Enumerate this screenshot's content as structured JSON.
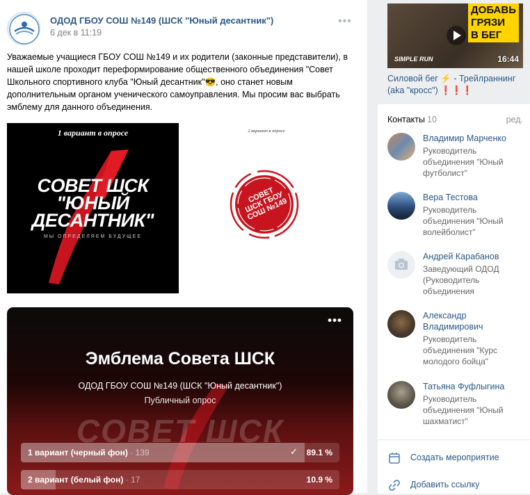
{
  "post": {
    "author": "ОДОД ГБОУ СОШ №149 (ШСК \"Юный десантник\")",
    "date": "6 дек в 11:19",
    "text_before_emoji": "Уважаемые учащиеся ГБОУ СОШ №149 и их родители (законные представители), в нашей школе проходит переформирование общественного объединения \"Совет Школьного спортивного клуба \"Юный десантник\"",
    "emoji": "😎",
    "text_after_emoji": ", оно станет новым дополнительным органом ученического самоуправления. Мы просим вас выбрать эмблему для данного объединения.",
    "image1": {
      "caption": "1 вариант в опросе",
      "line1": "СОВЕТ ШСК",
      "line2": "\"ЮНЫЙ",
      "line3": "ДЕСАНТНИК\"",
      "tagline": "МЫ ОПРЕДЕЛЯЕМ БУДУЩЕЕ"
    },
    "image2": {
      "caption": "2 вариант в опросе",
      "line1": "СОВЕТ",
      "line2": "ШСК ГБОУ",
      "line3": "СОШ №149"
    }
  },
  "poll": {
    "title": "Эмблема Совета ШСК",
    "owner": "ОДОД ГБОУ СОШ №149 (ШСК \"Юный десантник\")",
    "type": "Публичный опрос",
    "background_text": "СОВЕТ ШСК",
    "options": [
      {
        "label": "1 вариант (черный фон)",
        "count": "139",
        "percent": "89.1 %",
        "share": 0.891,
        "voted": true
      },
      {
        "label": "2 вариант (белый фон)",
        "count": "17",
        "percent": "10.9 %",
        "share": 0.109,
        "voted": false
      }
    ],
    "count_separator": " · "
  },
  "sidebar": {
    "video": {
      "overlay_line1": "ДОБАВЬ",
      "overlay_line2": "ГРЯЗИ",
      "overlay_line3": "В БЕГ",
      "brand": "SIMPLE RUN",
      "duration": "16:44",
      "caption": "Силовой бег ⚡ - Трейлраннинг (aka \"кросс\") ❗❗❗"
    },
    "contacts_label": "Контакты",
    "contacts_count": "10",
    "edit_label": "ред.",
    "contacts": [
      {
        "name": "Владимир Марченко",
        "desc": "Руководитель объединения \"Юный футболист\""
      },
      {
        "name": "Вера Тестова",
        "desc": "Руководитель объединения \"Юный волейболист\""
      },
      {
        "name": "Андрей Карабанов",
        "desc": "Заведующий ОДОД (Руководитель объединения"
      },
      {
        "name": "Александр Владимирович",
        "desc": "Руководитель объединения \"Курс молодого бойца\""
      },
      {
        "name": "Татьяна Фуфлыгина",
        "desc": "Руководитель объединения \"Юный шахматист\""
      }
    ],
    "create_event": "Создать мероприятие",
    "add_link": "Добавить ссылку"
  }
}
